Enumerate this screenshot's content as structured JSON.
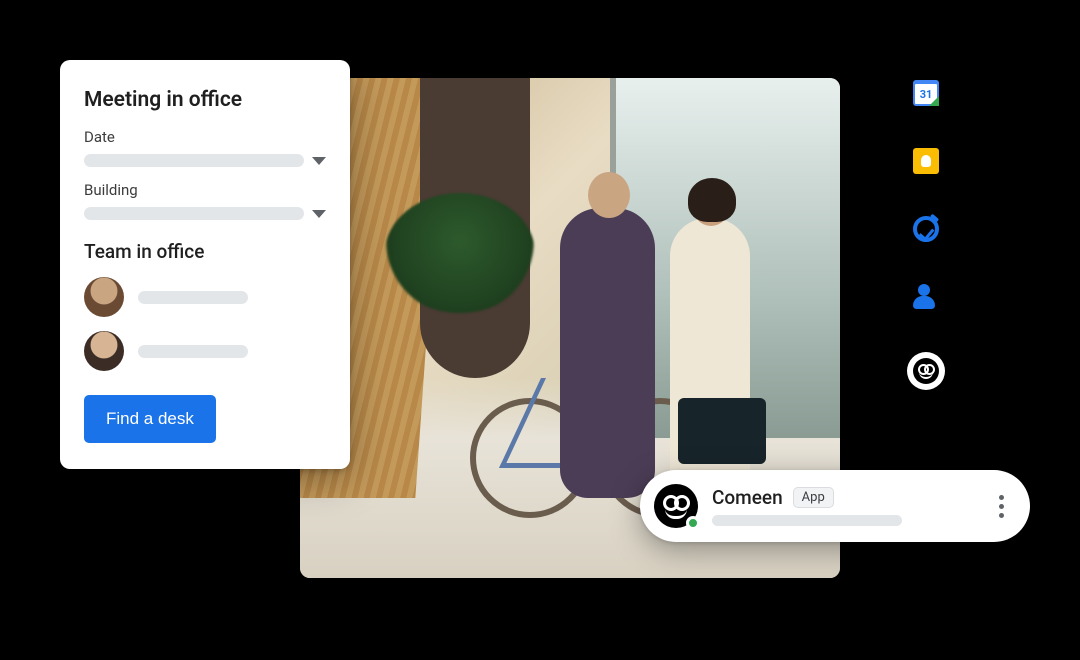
{
  "card": {
    "title": "Meeting in office",
    "date_label": "Date",
    "building_label": "Building",
    "team_heading": "Team in office",
    "find_button": "Find a desk"
  },
  "rail": {
    "calendar_day": "31",
    "icons": {
      "calendar": "calendar-icon",
      "keep": "keep-icon",
      "tasks": "tasks-icon",
      "contacts": "contacts-icon",
      "comeen": "comeen-icon"
    }
  },
  "chip": {
    "name": "Comeen",
    "badge": "App",
    "presence": "online"
  },
  "colors": {
    "primary": "#1a73e8",
    "calendar_blue": "#4285f4",
    "keep_yellow": "#fbbc04",
    "presence_green": "#34a853"
  }
}
